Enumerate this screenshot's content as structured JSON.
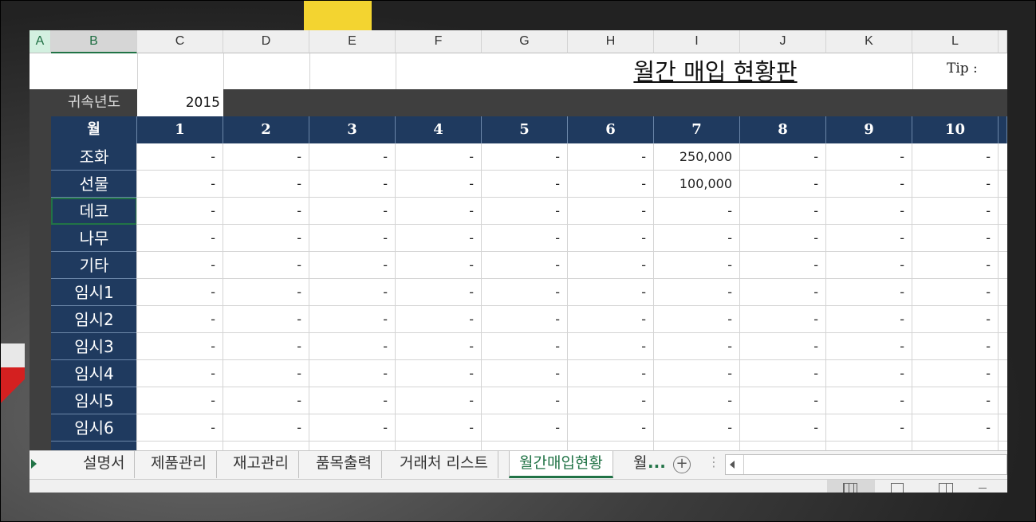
{
  "columns": [
    "A",
    "B",
    "C",
    "D",
    "E",
    "F",
    "G",
    "H",
    "I",
    "J",
    "K",
    "L"
  ],
  "title": "월간 매입 현황판",
  "tip": "Tip :",
  "year": {
    "label": "귀속년도",
    "value": "2015"
  },
  "month_header": {
    "label": "월",
    "months": [
      "1",
      "2",
      "3",
      "4",
      "5",
      "6",
      "7",
      "8",
      "9",
      "10"
    ]
  },
  "rows": [
    {
      "label": "조화",
      "values": [
        "-",
        "-",
        "-",
        "-",
        "-",
        "-",
        "250,000",
        "-",
        "-",
        "-"
      ]
    },
    {
      "label": "선물",
      "values": [
        "-",
        "-",
        "-",
        "-",
        "-",
        "-",
        "100,000",
        "-",
        "-",
        "-"
      ]
    },
    {
      "label": "데코",
      "values": [
        "-",
        "-",
        "-",
        "-",
        "-",
        "-",
        "-",
        "-",
        "-",
        "-"
      ]
    },
    {
      "label": "나무",
      "values": [
        "-",
        "-",
        "-",
        "-",
        "-",
        "-",
        "-",
        "-",
        "-",
        "-"
      ]
    },
    {
      "label": "기타",
      "values": [
        "-",
        "-",
        "-",
        "-",
        "-",
        "-",
        "-",
        "-",
        "-",
        "-"
      ]
    },
    {
      "label": "임시1",
      "values": [
        "-",
        "-",
        "-",
        "-",
        "-",
        "-",
        "-",
        "-",
        "-",
        "-"
      ]
    },
    {
      "label": "임시2",
      "values": [
        "-",
        "-",
        "-",
        "-",
        "-",
        "-",
        "-",
        "-",
        "-",
        "-"
      ]
    },
    {
      "label": "임시3",
      "values": [
        "-",
        "-",
        "-",
        "-",
        "-",
        "-",
        "-",
        "-",
        "-",
        "-"
      ]
    },
    {
      "label": "임시4",
      "values": [
        "-",
        "-",
        "-",
        "-",
        "-",
        "-",
        "-",
        "-",
        "-",
        "-"
      ]
    },
    {
      "label": "임시5",
      "values": [
        "-",
        "-",
        "-",
        "-",
        "-",
        "-",
        "-",
        "-",
        "-",
        "-"
      ]
    },
    {
      "label": "임시6",
      "values": [
        "-",
        "-",
        "-",
        "-",
        "-",
        "-",
        "-",
        "-",
        "-",
        "-"
      ]
    }
  ],
  "sheet_tabs": [
    "설명서",
    "제품관리",
    "재고관리",
    "품목출력",
    "거래처 리스트",
    "월간매입현황",
    "월"
  ],
  "active_tab": "월간매입현황",
  "tab_more": "...",
  "colors": {
    "header_navy": "#1f3a5f",
    "dark_band": "#3f3f3f",
    "excel_green": "#217346"
  }
}
